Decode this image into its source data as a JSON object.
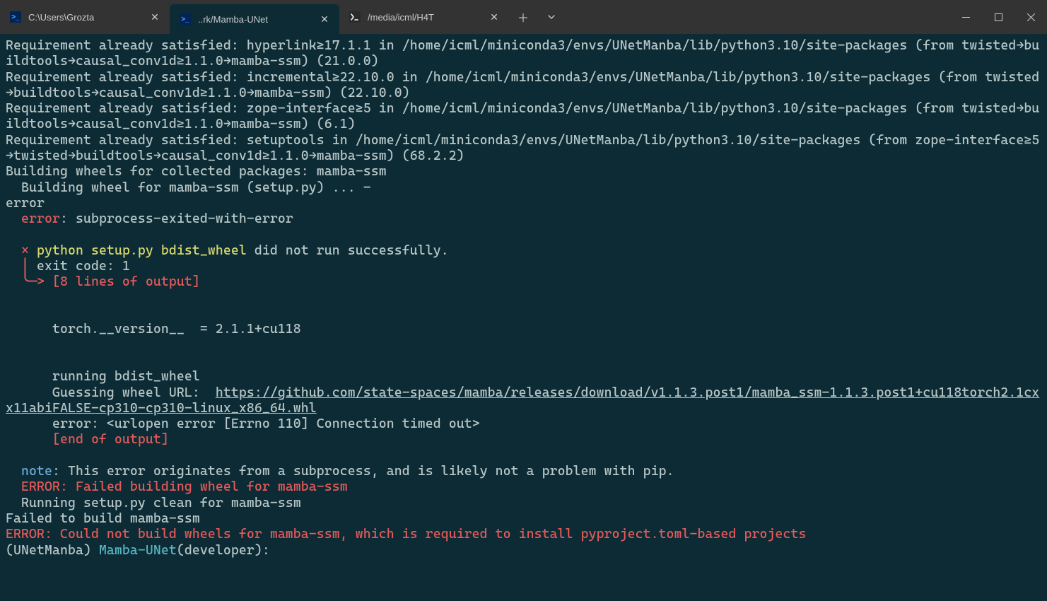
{
  "tabs": [
    {
      "label": "C:\\Users\\Grozta",
      "type": "ps"
    },
    {
      "label": "..rk/Mamba-UNet",
      "type": "ps"
    },
    {
      "label": "/media/icml/H4T",
      "type": "bash"
    }
  ],
  "terminal": {
    "req1": "Requirement already satisfied: hyperlink≥17.1.1 in /home/icml/miniconda3/envs/UNetManba/lib/python3.10/site-packages (from twisted→buildtools→causal_conv1d≥1.1.0→mamba-ssm) (21.0.0)",
    "req2": "Requirement already satisfied: incremental≥22.10.0 in /home/icml/miniconda3/envs/UNetManba/lib/python3.10/site-packages (from twisted→buildtools→causal_conv1d≥1.1.0→mamba-ssm) (22.10.0)",
    "req3": "Requirement already satisfied: zope-interface≥5 in /home/icml/miniconda3/envs/UNetManba/lib/python3.10/site-packages (from twisted→buildtools→causal_conv1d≥1.1.0→mamba-ssm) (6.1)",
    "req4": "Requirement already satisfied: setuptools in /home/icml/miniconda3/envs/UNetManba/lib/python3.10/site-packages (from zope-interface≥5→twisted→buildtools→causal_conv1d≥1.1.0→mamba-ssm) (68.2.2)",
    "build1": "Building wheels for collected packages: mamba-ssm",
    "build2": "  Building wheel for mamba-ssm (setup.py) ... -",
    "err_hdr": "error",
    "err_label": "error",
    "err_msg": ": subprocess-exited-with-error",
    "x": "×",
    "py_cmd": "python setup.py bdist_wheel",
    "py_fail": " did not run successfully.",
    "pipe": "│ ",
    "exit": "exit code: 1",
    "arrow": "╰─>",
    "lines_out": " [8 lines of output]",
    "torch": "      torch.__version__  = 2.1.1+cu118",
    "bdist": "      running bdist_wheel",
    "guess": "      Guessing wheel URL:  ",
    "url": "https://github.com/state-spaces/mamba/releases/download/v1.1.3.post1/mamba_ssm-1.1.3.post1+cu118torch2.1cxx11abiFALSE-cp310-cp310-linux_x86_64.whl",
    "urlerr": "      error: <urlopen error [Errno 110] Connection timed out>",
    "endout": "      [end of output]",
    "note_lbl": "note",
    "note_msg": ": This error originates from a subprocess, and is likely not a problem with pip.",
    "err_build": "  ERROR: Failed building wheel for mamba-ssm",
    "clean": "  Running setup.py clean for mamba-ssm",
    "fail": "Failed to build mamba-ssm",
    "err_final": "ERROR: Could not build wheels for mamba-ssm, which is required to install pyproject.toml-based projects",
    "prompt_env": "(UNetManba) ",
    "prompt_path": "Mamba-UNet",
    "prompt_tail": "(developer):"
  }
}
